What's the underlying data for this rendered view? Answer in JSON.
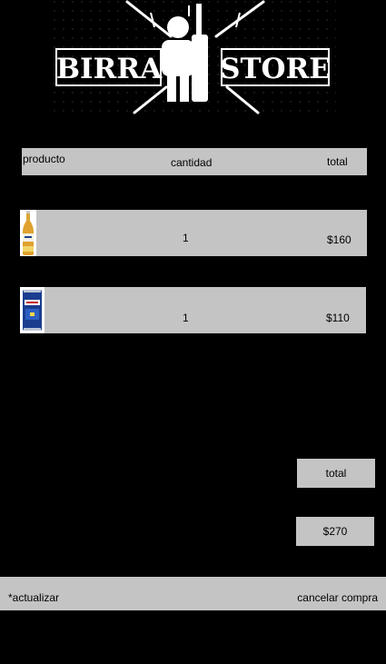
{
  "logo": {
    "left_word": "BIRRA",
    "right_word": "STORE"
  },
  "table": {
    "col_product": "producto",
    "col_quantity": "cantidad",
    "col_total": "total"
  },
  "items": [
    {
      "image": "corona-beer-bottle",
      "quantity": "1",
      "price": "$160"
    },
    {
      "image": "blue-beer-can",
      "quantity": "1",
      "price": "$110"
    }
  ],
  "summary": {
    "total_label": "total",
    "total_value": "$270"
  },
  "footer": {
    "update_label": "*actualizar",
    "cancel_label": "cancelar compra"
  }
}
